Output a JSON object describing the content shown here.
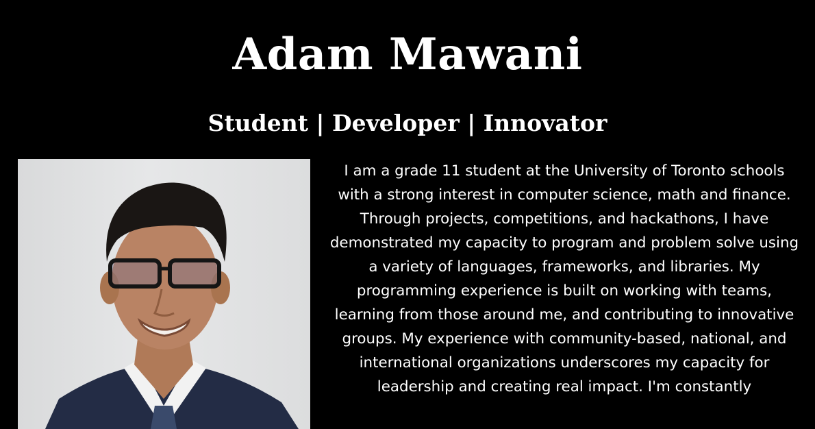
{
  "header": {
    "name": "Adam Mawani",
    "tagline": "Student | Developer | Innovator"
  },
  "about": {
    "bio": "I am a grade 11 student at the University of Toronto schools with a strong interest in computer science, math and finance. Through projects, competitions, and hackathons, I have demonstrated my capacity to program and problem solve using a variety of languages, frameworks, and libraries. My programming experience is built on working with teams, learning from those around me, and contributing to innovative groups. My experience with community-based, national, and international organizations underscores my capacity for leadership and creating real impact. I'm constantly"
  },
  "colors": {
    "background": "#000000",
    "text": "#ffffff"
  }
}
